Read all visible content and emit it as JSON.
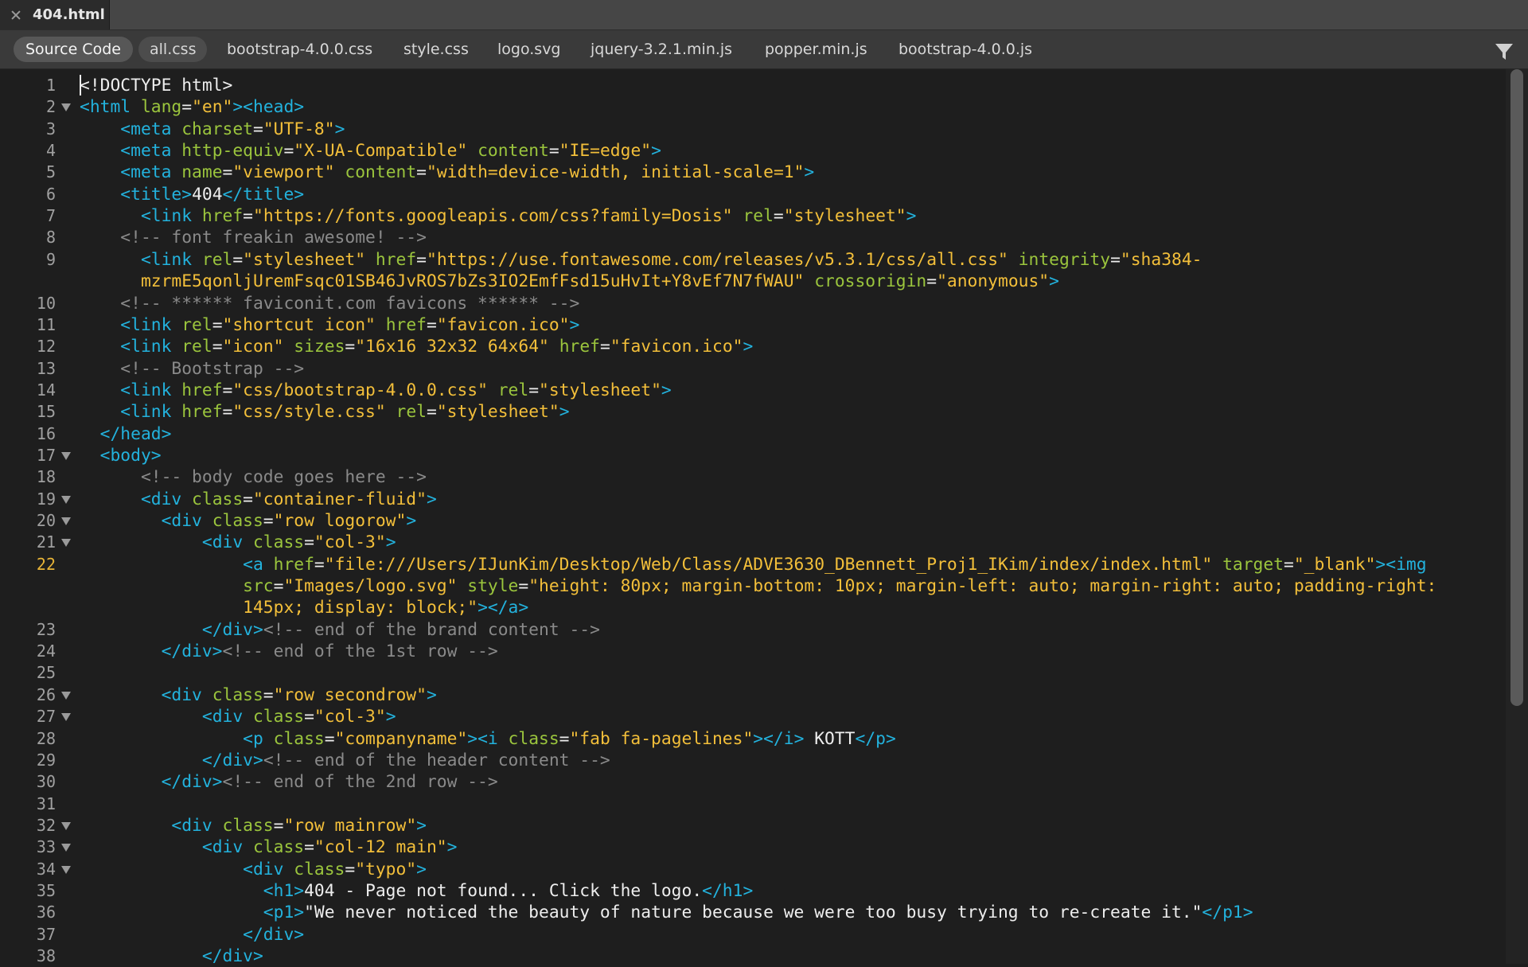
{
  "document_tab": {
    "title": "404.html",
    "close_icon": "close-icon"
  },
  "related_files": {
    "items": [
      {
        "label": "Source Code",
        "active": true
      },
      {
        "label": "all.css",
        "active": false
      },
      {
        "label": "bootstrap-4.0.0.css",
        "active": false
      },
      {
        "label": "style.css",
        "active": false
      },
      {
        "label": "logo.svg",
        "active": false
      },
      {
        "label": "jquery-3.2.1.min.js",
        "active": false
      },
      {
        "label": "popper.min.js",
        "active": false
      },
      {
        "label": "bootstrap-4.0.0.js",
        "active": false
      }
    ],
    "filter_icon": "filter-icon"
  },
  "colors": {
    "tag": "#23b2dd",
    "attribute": "#9bc53d",
    "string": "#f3bf3a",
    "comment": "#8a8a8a",
    "text": "#eeeeee",
    "current_line_number": "#e8b437"
  },
  "editor": {
    "current_line": 22,
    "fold_lines": [
      2,
      17,
      19,
      20,
      21,
      26,
      27,
      32,
      33,
      34
    ],
    "lines": [
      {
        "n": 1,
        "segments": [
          [
            "tx",
            "<!DOCTYPE html>"
          ]
        ]
      },
      {
        "n": 2,
        "segments": [
          [
            "tg",
            "<html "
          ],
          [
            "at",
            "lang"
          ],
          [
            "tx",
            "="
          ],
          [
            "st",
            "\"en\""
          ],
          [
            "tg",
            "><head>"
          ]
        ]
      },
      {
        "n": 3,
        "segments": [
          [
            "tx",
            "    "
          ],
          [
            "tg",
            "<meta "
          ],
          [
            "at",
            "charset"
          ],
          [
            "tx",
            "="
          ],
          [
            "st",
            "\"UTF-8\""
          ],
          [
            "tg",
            ">"
          ]
        ]
      },
      {
        "n": 4,
        "segments": [
          [
            "tx",
            "    "
          ],
          [
            "tg",
            "<meta "
          ],
          [
            "at",
            "http-equiv"
          ],
          [
            "tx",
            "="
          ],
          [
            "st",
            "\"X-UA-Compatible\""
          ],
          [
            "tx",
            " "
          ],
          [
            "at",
            "content"
          ],
          [
            "tx",
            "="
          ],
          [
            "st",
            "\"IE=edge\""
          ],
          [
            "tg",
            ">"
          ]
        ]
      },
      {
        "n": 5,
        "segments": [
          [
            "tx",
            "    "
          ],
          [
            "tg",
            "<meta "
          ],
          [
            "at",
            "name"
          ],
          [
            "tx",
            "="
          ],
          [
            "st",
            "\"viewport\""
          ],
          [
            "tx",
            " "
          ],
          [
            "at",
            "content"
          ],
          [
            "tx",
            "="
          ],
          [
            "st",
            "\"width=device-width, initial-scale=1\""
          ],
          [
            "tg",
            ">"
          ]
        ]
      },
      {
        "n": 6,
        "segments": [
          [
            "tx",
            "    "
          ],
          [
            "tg",
            "<title>"
          ],
          [
            "tx",
            "404"
          ],
          [
            "tg",
            "</title>"
          ]
        ]
      },
      {
        "n": 7,
        "segments": [
          [
            "tx",
            "      "
          ],
          [
            "tg",
            "<link "
          ],
          [
            "at",
            "href"
          ],
          [
            "tx",
            "="
          ],
          [
            "st",
            "\"https://fonts.googleapis.com/css?family=Dosis\""
          ],
          [
            "tx",
            " "
          ],
          [
            "at",
            "rel"
          ],
          [
            "tx",
            "="
          ],
          [
            "st",
            "\"stylesheet\""
          ],
          [
            "tg",
            ">"
          ]
        ]
      },
      {
        "n": 8,
        "segments": [
          [
            "tx",
            "    "
          ],
          [
            "cm",
            "<!-- font freakin awesome! -->"
          ]
        ]
      },
      {
        "n": 9,
        "segments": [
          [
            "tx",
            "      "
          ],
          [
            "tg",
            "<link "
          ],
          [
            "at",
            "rel"
          ],
          [
            "tx",
            "="
          ],
          [
            "st",
            "\"stylesheet\""
          ],
          [
            "tx",
            " "
          ],
          [
            "at",
            "href"
          ],
          [
            "tx",
            "="
          ],
          [
            "st",
            "\"https://use.fontawesome.com/releases/v5.3.1/css/all.css\""
          ],
          [
            "tx",
            " "
          ],
          [
            "at",
            "integrity"
          ],
          [
            "tx",
            "="
          ],
          [
            "st",
            "\"sha384-"
          ]
        ]
      },
      {
        "n": null,
        "segments": [
          [
            "tx",
            "      "
          ],
          [
            "st",
            "mzrmE5qonljUremFsqc01SB46JvROS7bZs3IO2EmfFsd15uHvIt+Y8vEf7N7fWAU\""
          ],
          [
            "tx",
            " "
          ],
          [
            "at",
            "crossorigin"
          ],
          [
            "tx",
            "="
          ],
          [
            "st",
            "\"anonymous\""
          ],
          [
            "tg",
            ">"
          ]
        ]
      },
      {
        "n": 10,
        "segments": [
          [
            "tx",
            "    "
          ],
          [
            "cm",
            "<!-- ****** faviconit.com favicons ****** -->"
          ]
        ]
      },
      {
        "n": 11,
        "segments": [
          [
            "tx",
            "    "
          ],
          [
            "tg",
            "<link "
          ],
          [
            "at",
            "rel"
          ],
          [
            "tx",
            "="
          ],
          [
            "st",
            "\"shortcut icon\""
          ],
          [
            "tx",
            " "
          ],
          [
            "at",
            "href"
          ],
          [
            "tx",
            "="
          ],
          [
            "st",
            "\"favicon.ico\""
          ],
          [
            "tg",
            ">"
          ]
        ]
      },
      {
        "n": 12,
        "segments": [
          [
            "tx",
            "    "
          ],
          [
            "tg",
            "<link "
          ],
          [
            "at",
            "rel"
          ],
          [
            "tx",
            "="
          ],
          [
            "st",
            "\"icon\""
          ],
          [
            "tx",
            " "
          ],
          [
            "at",
            "sizes"
          ],
          [
            "tx",
            "="
          ],
          [
            "st",
            "\"16x16 32x32 64x64\""
          ],
          [
            "tx",
            " "
          ],
          [
            "at",
            "href"
          ],
          [
            "tx",
            "="
          ],
          [
            "st",
            "\"favicon.ico\""
          ],
          [
            "tg",
            ">"
          ]
        ]
      },
      {
        "n": 13,
        "segments": [
          [
            "tx",
            "    "
          ],
          [
            "cm",
            "<!-- Bootstrap -->"
          ]
        ]
      },
      {
        "n": 14,
        "segments": [
          [
            "tx",
            "    "
          ],
          [
            "tg",
            "<link "
          ],
          [
            "at",
            "href"
          ],
          [
            "tx",
            "="
          ],
          [
            "st",
            "\"css/bootstrap-4.0.0.css\""
          ],
          [
            "tx",
            " "
          ],
          [
            "at",
            "rel"
          ],
          [
            "tx",
            "="
          ],
          [
            "st",
            "\"stylesheet\""
          ],
          [
            "tg",
            ">"
          ]
        ]
      },
      {
        "n": 15,
        "segments": [
          [
            "tx",
            "    "
          ],
          [
            "tg",
            "<link "
          ],
          [
            "at",
            "href"
          ],
          [
            "tx",
            "="
          ],
          [
            "st",
            "\"css/style.css\""
          ],
          [
            "tx",
            " "
          ],
          [
            "at",
            "rel"
          ],
          [
            "tx",
            "="
          ],
          [
            "st",
            "\"stylesheet\""
          ],
          [
            "tg",
            ">"
          ]
        ]
      },
      {
        "n": 16,
        "segments": [
          [
            "tx",
            "  "
          ],
          [
            "tg",
            "</head>"
          ]
        ]
      },
      {
        "n": 17,
        "segments": [
          [
            "tx",
            "  "
          ],
          [
            "tg",
            "<body>"
          ]
        ]
      },
      {
        "n": 18,
        "segments": [
          [
            "tx",
            "      "
          ],
          [
            "cm",
            "<!-- body code goes here -->"
          ]
        ]
      },
      {
        "n": 19,
        "segments": [
          [
            "tx",
            "      "
          ],
          [
            "tg",
            "<div "
          ],
          [
            "at",
            "class"
          ],
          [
            "tx",
            "="
          ],
          [
            "st",
            "\"container-fluid\""
          ],
          [
            "tg",
            ">"
          ]
        ]
      },
      {
        "n": 20,
        "segments": [
          [
            "tx",
            "        "
          ],
          [
            "tg",
            "<div "
          ],
          [
            "at",
            "class"
          ],
          [
            "tx",
            "="
          ],
          [
            "st",
            "\"row logorow\""
          ],
          [
            "tg",
            ">"
          ]
        ]
      },
      {
        "n": 21,
        "segments": [
          [
            "tx",
            "            "
          ],
          [
            "tg",
            "<div "
          ],
          [
            "at",
            "class"
          ],
          [
            "tx",
            "="
          ],
          [
            "st",
            "\"col-3\""
          ],
          [
            "tg",
            ">"
          ]
        ]
      },
      {
        "n": 22,
        "segments": [
          [
            "tx",
            "                "
          ],
          [
            "tg",
            "<a "
          ],
          [
            "at",
            "href"
          ],
          [
            "tx",
            "="
          ],
          [
            "st",
            "\"file:///Users/IJunKim/Desktop/Web/Class/ADVE3630_DBennett_Proj1_IKim/index/index.html\""
          ],
          [
            "tx",
            " "
          ],
          [
            "at",
            "target"
          ],
          [
            "tx",
            "="
          ],
          [
            "st",
            "\"_blank\""
          ],
          [
            "tg",
            "><img"
          ]
        ]
      },
      {
        "n": null,
        "segments": [
          [
            "tx",
            "                "
          ],
          [
            "at",
            "src"
          ],
          [
            "tx",
            "="
          ],
          [
            "st",
            "\"Images/logo.svg\""
          ],
          [
            "tx",
            " "
          ],
          [
            "at",
            "style"
          ],
          [
            "tx",
            "="
          ],
          [
            "st",
            "\"height: 80px; margin-bottom: 10px; margin-left: auto; margin-right: auto; padding-right:"
          ]
        ]
      },
      {
        "n": null,
        "segments": [
          [
            "tx",
            "                "
          ],
          [
            "st",
            "145px; display: block;\""
          ],
          [
            "tg",
            "></a>"
          ]
        ]
      },
      {
        "n": 23,
        "segments": [
          [
            "tx",
            "            "
          ],
          [
            "tg",
            "</div>"
          ],
          [
            "cm",
            "<!-- end of the brand content -->"
          ]
        ]
      },
      {
        "n": 24,
        "segments": [
          [
            "tx",
            "        "
          ],
          [
            "tg",
            "</div>"
          ],
          [
            "cm",
            "<!-- end of the 1st row -->"
          ]
        ]
      },
      {
        "n": 25,
        "segments": []
      },
      {
        "n": 26,
        "segments": [
          [
            "tx",
            "        "
          ],
          [
            "tg",
            "<div "
          ],
          [
            "at",
            "class"
          ],
          [
            "tx",
            "="
          ],
          [
            "st",
            "\"row secondrow\""
          ],
          [
            "tg",
            ">"
          ]
        ]
      },
      {
        "n": 27,
        "segments": [
          [
            "tx",
            "            "
          ],
          [
            "tg",
            "<div "
          ],
          [
            "at",
            "class"
          ],
          [
            "tx",
            "="
          ],
          [
            "st",
            "\"col-3\""
          ],
          [
            "tg",
            ">"
          ]
        ]
      },
      {
        "n": 28,
        "segments": [
          [
            "tx",
            "                "
          ],
          [
            "tg",
            "<p "
          ],
          [
            "at",
            "class"
          ],
          [
            "tx",
            "="
          ],
          [
            "st",
            "\"companyname\""
          ],
          [
            "tg",
            "><i "
          ],
          [
            "at",
            "class"
          ],
          [
            "tx",
            "="
          ],
          [
            "st",
            "\"fab fa-pagelines\""
          ],
          [
            "tg",
            "></i>"
          ],
          [
            "tx",
            " KOTT"
          ],
          [
            "tg",
            "</p>"
          ]
        ]
      },
      {
        "n": 29,
        "segments": [
          [
            "tx",
            "            "
          ],
          [
            "tg",
            "</div>"
          ],
          [
            "cm",
            "<!-- end of the header content -->"
          ]
        ]
      },
      {
        "n": 30,
        "segments": [
          [
            "tx",
            "        "
          ],
          [
            "tg",
            "</div>"
          ],
          [
            "cm",
            "<!-- end of the 2nd row -->"
          ]
        ]
      },
      {
        "n": 31,
        "segments": []
      },
      {
        "n": 32,
        "segments": [
          [
            "tx",
            "         "
          ],
          [
            "tg",
            "<div "
          ],
          [
            "at",
            "class"
          ],
          [
            "tx",
            "="
          ],
          [
            "st",
            "\"row mainrow\""
          ],
          [
            "tg",
            ">"
          ]
        ]
      },
      {
        "n": 33,
        "segments": [
          [
            "tx",
            "            "
          ],
          [
            "tg",
            "<div "
          ],
          [
            "at",
            "class"
          ],
          [
            "tx",
            "="
          ],
          [
            "st",
            "\"col-12 main\""
          ],
          [
            "tg",
            ">"
          ]
        ]
      },
      {
        "n": 34,
        "segments": [
          [
            "tx",
            "                "
          ],
          [
            "tg",
            "<div "
          ],
          [
            "at",
            "class"
          ],
          [
            "tx",
            "="
          ],
          [
            "st",
            "\"typo\""
          ],
          [
            "tg",
            ">"
          ]
        ]
      },
      {
        "n": 35,
        "segments": [
          [
            "tx",
            "                  "
          ],
          [
            "tg",
            "<h1>"
          ],
          [
            "tx",
            "404 - Page not found... Click the logo."
          ],
          [
            "tg",
            "</h1>"
          ]
        ]
      },
      {
        "n": 36,
        "segments": [
          [
            "tx",
            "                  "
          ],
          [
            "tg",
            "<p1>"
          ],
          [
            "tx",
            "\"We never noticed the beauty of nature because we were too busy trying to re-create it.\""
          ],
          [
            "tg",
            "</p1>"
          ]
        ]
      },
      {
        "n": 37,
        "segments": [
          [
            "tx",
            "                "
          ],
          [
            "tg",
            "</div>"
          ]
        ]
      },
      {
        "n": 38,
        "segments": [
          [
            "tx",
            "            "
          ],
          [
            "tg",
            "</div>"
          ]
        ]
      }
    ]
  }
}
